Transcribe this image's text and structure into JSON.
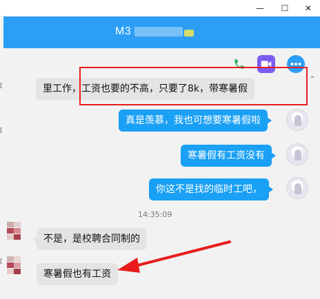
{
  "window": {
    "minimize_glyph": "—",
    "maximize_glyph": "☐",
    "close_glyph": "✕"
  },
  "header": {
    "contact_name_prefix": "M3",
    "background_color": "#2c9ef6"
  },
  "actions": [
    {
      "icon": "phone-icon",
      "color": "#1fae59"
    },
    {
      "icon": "video-icon",
      "color": "#7b5cf0"
    },
    {
      "icon": "more-icon",
      "color": "#2c9ef6"
    }
  ],
  "messages": [
    {
      "side": "in",
      "text": "里工作，工资也要的不高，只要了8k，带寒暑假",
      "highlighted": true
    },
    {
      "side": "out",
      "text": "真是羡慕，我也可想要寒暑假啦"
    },
    {
      "side": "out",
      "text": "寒暑假有工资没有"
    },
    {
      "side": "out",
      "text": "你这不是找的临时工吧，"
    },
    {
      "side": "in",
      "text": "不是，是校聘合同制的"
    },
    {
      "side": "in",
      "text": "寒暑假也有工资",
      "arrow_pointed": true
    }
  ],
  "timestamp": "14:35:09",
  "annotation_color": "#e81c1c",
  "left_strip_marks": [
    "[",
    "[",
    "["
  ],
  "scroll_glyph": "^"
}
